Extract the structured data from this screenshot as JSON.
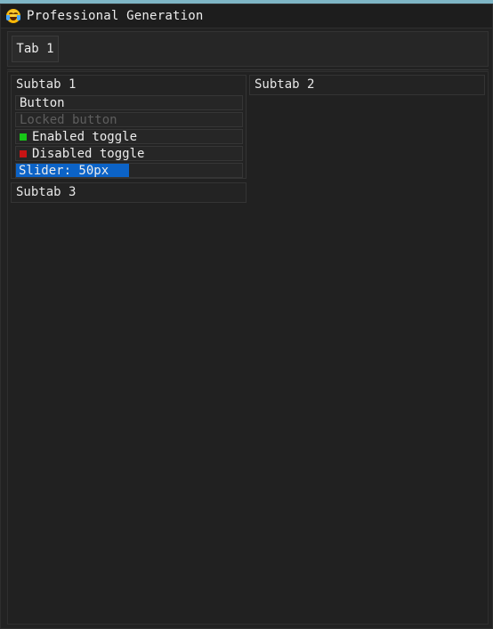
{
  "window": {
    "title": "Professional Generation",
    "icon": "crying-laughing-emoji-icon"
  },
  "tabs": [
    {
      "label": "Tab 1"
    }
  ],
  "subtabs": {
    "subtab1": {
      "title": "Subtab 1",
      "button_label": "Button",
      "locked_button_label": "Locked button",
      "enabled_toggle": {
        "label": "Enabled toggle",
        "state": true,
        "color": "#17c617"
      },
      "disabled_toggle": {
        "label": "Disabled toggle",
        "state": false,
        "color": "#c81414"
      },
      "slider": {
        "label": "Slider: 50px",
        "value": 50,
        "fill_fraction": 0.5,
        "color": "#0c63c7"
      }
    },
    "subtab2": {
      "title": "Subtab 2"
    },
    "subtab3": {
      "title": "Subtab 3"
    }
  }
}
